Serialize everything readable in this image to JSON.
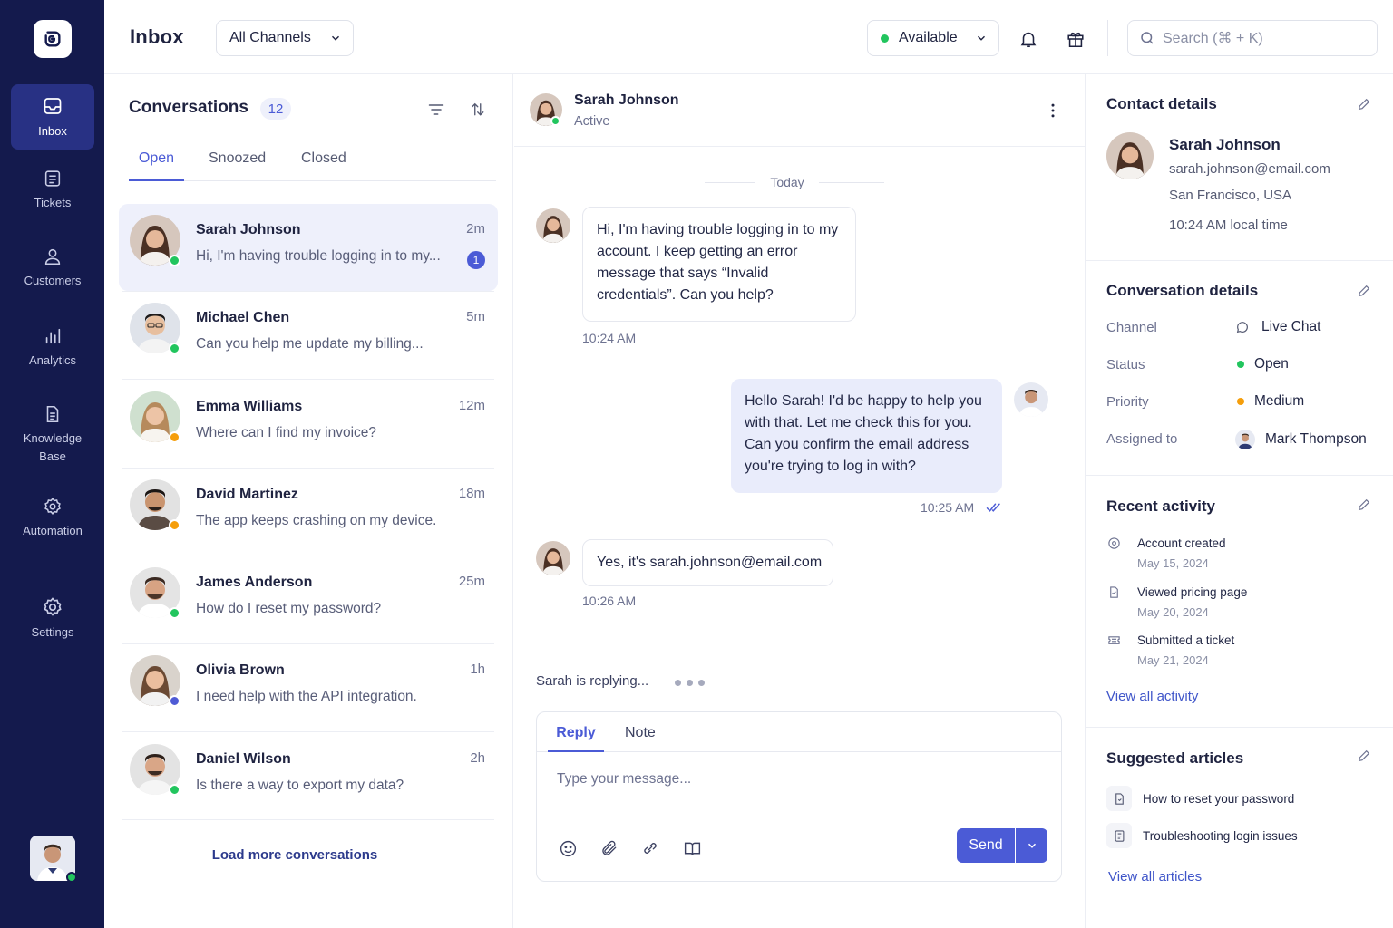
{
  "nav": {
    "items": [
      {
        "label": "Inbox"
      },
      {
        "label": "Tickets"
      },
      {
        "label": "Customers"
      },
      {
        "label": "Analytics"
      },
      {
        "label": "Knowledge Base"
      },
      {
        "label": "Automation"
      },
      {
        "label": "Settings"
      }
    ]
  },
  "header": {
    "title": "Inbox",
    "channel_filter": "All Channels",
    "status": "Available",
    "status_color": "#22c55e",
    "search_placeholder": "Search (⌘ + K)"
  },
  "conversations": {
    "title": "Conversations",
    "count": "12",
    "tabs": [
      "Open",
      "Snoozed",
      "Closed"
    ],
    "items": [
      {
        "name": "Sarah Johnson",
        "time": "2m",
        "preview": "Hi, I'm having trouble logging in to my...",
        "unread": "1",
        "status_color": "#22c55e"
      },
      {
        "name": "Michael Chen",
        "time": "5m",
        "preview": "Can you help me update my billing...",
        "status_color": "#22c55e"
      },
      {
        "name": "Emma Williams",
        "time": "12m",
        "preview": "Where can I find my invoice?",
        "status_color": "#f59e0b"
      },
      {
        "name": "David Martinez",
        "time": "18m",
        "preview": "The app keeps crashing on my device.",
        "status_color": "#f59e0b"
      },
      {
        "name": "James Anderson",
        "time": "25m",
        "preview": "How do I reset my password?",
        "status_color": "#22c55e"
      },
      {
        "name": "Olivia Brown",
        "time": "1h",
        "preview": "I need help with the API integration.",
        "status_color": "#4f5bd5"
      },
      {
        "name": "Daniel Wilson",
        "time": "2h",
        "preview": "Is there a way to export my data?",
        "status_color": "#22c55e"
      }
    ],
    "load_more": "Load more conversations"
  },
  "chat": {
    "contact_name": "Sarah Johnson",
    "contact_status": "Active",
    "day_divider": "Today",
    "messages": [
      {
        "text": "Hi, I'm having trouble logging in to my account. I keep getting an error message that says “Invalid credentials”. Can you help?",
        "time": "10:24 AM"
      },
      {
        "text": "Hello Sarah! I'd be happy to help you with that. Let me check this for you. Can you confirm the email address you're trying to log in with?",
        "time": "10:25 AM"
      },
      {
        "text": "Yes, it's sarah.johnson@email.com",
        "time": "10:26 AM"
      }
    ],
    "typing": "Sarah is replying...",
    "composer": {
      "tabs": [
        "Reply",
        "Note"
      ],
      "placeholder": "Type your message...",
      "send_label": "Send"
    }
  },
  "contact": {
    "section_title": "Contact details",
    "name": "Sarah Johnson",
    "email": "sarah.johnson@email.com",
    "location": "San Francisco, USA",
    "local_time": "10:24 AM local time"
  },
  "conversation_details": {
    "title": "Conversation details",
    "rows": [
      {
        "label": "Channel",
        "value": "Live Chat"
      },
      {
        "label": "Status",
        "value": "Open",
        "color": "#22c55e"
      },
      {
        "label": "Priority",
        "value": "Medium",
        "color": "#f59e0b"
      },
      {
        "label": "Assigned to",
        "value": "Mark Thompson"
      }
    ]
  },
  "recent_activity": {
    "title": "Recent activity",
    "items": [
      {
        "label": "Account created",
        "date": "May 15, 2024"
      },
      {
        "label": "Viewed pricing page",
        "date": "May 20, 2024"
      },
      {
        "label": "Submitted a ticket",
        "date": "May 21, 2024"
      }
    ],
    "view_all": "View all activity"
  },
  "suggested_articles": {
    "title": "Suggested articles",
    "items": [
      "How to reset your password",
      "Troubleshooting login issues"
    ],
    "view_all": "View all articles"
  }
}
